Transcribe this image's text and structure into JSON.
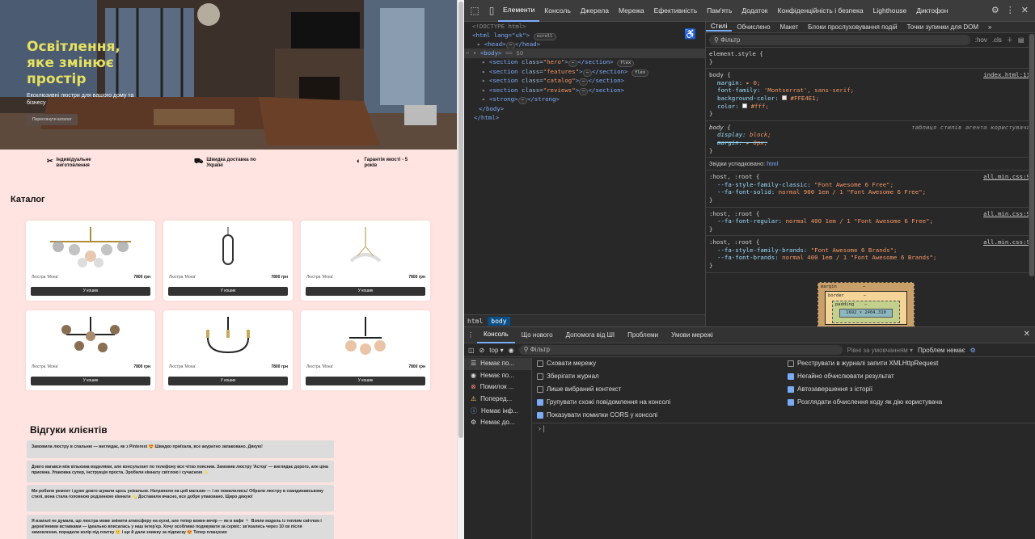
{
  "hero": {
    "title": "Освітлення, яке змінює простір",
    "subtitle": "Ексклюзивні люстри для вашого дому та бізнесу",
    "button": "Переглянути каталог"
  },
  "features": [
    {
      "icon": "tools-icon",
      "label": "Індивідуальне виготовлення"
    },
    {
      "icon": "truck-icon",
      "label": "Швидка доставка по Україні"
    },
    {
      "icon": "shield-icon",
      "label": "Гарантія якості - 5 років"
    }
  ],
  "catalog": {
    "title": "Каталог",
    "items": [
      {
        "name": "Люстра 'Мона'",
        "price": "7800 грн",
        "button": "У кошик"
      },
      {
        "name": "Люстра 'Мона'",
        "price": "7800 грн",
        "button": "У кошик"
      },
      {
        "name": "Люстра 'Мона'",
        "price": "7800 грн",
        "button": "У кошик"
      },
      {
        "name": "Люстра 'Мона'",
        "price": "7800 грн",
        "button": "У кошик"
      },
      {
        "name": "Люстра 'Мона'",
        "price": "7800 грн",
        "button": "У кошик"
      },
      {
        "name": "Люстра 'Мона'",
        "price": "7800 грн",
        "button": "У кошик"
      }
    ]
  },
  "reviews": {
    "title": "Відгуки клієнтів",
    "items": [
      "Замовила люстру в спальню — виглядає, як з Pinterest 😍 Швидко приїхала, все акуратно запаковано. Дякую!",
      "Довго вагався між кількома моделями, але консультант по телефону все чітко пояснив. Замовив люстру 'Астор' — виглядає дорого, але ціна приємна. Упаковка супер, інструкція проста. Зробили кімнату світлою і сучасною ✨",
      "Ми робили ремонт і дуже довго шукали щось унікальне. Натрапили на цей магазин — і не помилились! Обрали люстру в скандинавському стилі, вона стала головною родзинкою кімнати 💫 Доставили вчасно, все добре упаковано. Щиро дякую!",
      "Я взагалі не думала, що люстра може змінити атмосферу на кухні, але тепер кожен вечір — як в кафе ☕ Взяли модель із теплим світлом і дерев'яними вставками — ідеально вписалась у наш інтер'єр. Хочу особливо подякувати за сервіс: зв'язались через 10 хв після замовлення, порадили колір під плитку 🙂 і ще й дали знижку за підписку 😍 Тепер плануємо"
    ]
  },
  "devtools": {
    "tabs": [
      "Елементи",
      "Консоль",
      "Джерела",
      "Мережа",
      "Ефективність",
      "Пам'ять",
      "Додаток",
      "Конфіденційність і безпека",
      "Lighthouse",
      "Диктофон"
    ],
    "active_tab": "Елементи",
    "dom": {
      "doctype": "<!DOCTYPE html>",
      "html_open": "<html lang=\"uk\">",
      "scroll_badge": "scroll",
      "head": "<head>",
      "head_close": "</head>",
      "body_open": "<body>",
      "body_eq": "== $0",
      "sections": [
        {
          "cls": "hero",
          "badge": "flex"
        },
        {
          "cls": "features",
          "badge": "flex"
        },
        {
          "cls": "catalog",
          "badge": ""
        },
        {
          "cls": "reviews",
          "badge": ""
        }
      ],
      "strong": "<strong>",
      "strong_close": "</strong>",
      "body_close": "</body>",
      "html_close": "</html>"
    },
    "breadcrumbs": [
      "html",
      "body"
    ],
    "styles_tabs": [
      "Стилі",
      "Обчислено",
      "Макет",
      "Блоки прослуховування подій",
      "Точки зупинки для DOM"
    ],
    "filter_placeholder": "Фільтр",
    "filter_tools": [
      ":hov",
      ".cls"
    ],
    "rules": {
      "element_style": "element.style {",
      "body_selector": "body {",
      "body_src": "index.html:11",
      "body_props": [
        {
          "k": "margin",
          "v": "▸ 0;"
        },
        {
          "k": "font-family",
          "v": "'Montserrat', sans-serif;"
        },
        {
          "k": "background-color",
          "v": "#FFE4E1;"
        },
        {
          "k": "color",
          "v": "#fff;"
        }
      ],
      "ua_selector": "body {",
      "ua_note": "таблиця стилів агента користувача",
      "ua_props": [
        {
          "k": "display",
          "v": "block;"
        },
        {
          "k": "margin",
          "v": "▸ 8px;"
        }
      ],
      "inherited_label": "Звідки успадковано:",
      "inherited_from": "html",
      "root_rules": [
        {
          "sel": ":host, :root {",
          "src": "all.min.css:9",
          "props": [
            {
              "k": "--fa-style-family-classic",
              "v": "\"Font Awesome 6 Free\";"
            },
            {
              "k": "--fa-font-solid",
              "v": "normal 900 1em / 1 \"Font Awesome 6 Free\";"
            }
          ]
        },
        {
          "sel": ":host, :root {",
          "src": "all.min.css:9",
          "props": [
            {
              "k": "--fa-font-regular",
              "v": "normal 400 1em / 1 \"Font Awesome 6 Free\";"
            }
          ]
        },
        {
          "sel": ":host, :root {",
          "src": "all.min.css:9",
          "props": [
            {
              "k": "--fa-style-family-brands",
              "v": "\"Font Awesome 6 Brands\";"
            },
            {
              "k": "--fa-font-brands",
              "v": "normal 400 1em / 1 \"Font Awesome 6 Brands\";"
            }
          ]
        }
      ],
      "close": "}"
    },
    "boxmodel": {
      "margin": "margin",
      "border": "border",
      "padding": "padding",
      "size": "1692 × 2404.310",
      "dash": "–"
    },
    "console": {
      "tabs": [
        "Консоль",
        "Що нового",
        "Допомога від ШІ",
        "Проблеми",
        "Умови мережі"
      ],
      "context": "top",
      "filter": "Фільтр",
      "levels": "Рівні за умовчанням",
      "issues": "Проблем немає",
      "sidebar": [
        {
          "icon": "list-icon",
          "label": "Немає по..."
        },
        {
          "icon": "user-icon",
          "label": "Немає по..."
        },
        {
          "icon": "error-icon",
          "label": "Помилок ..."
        },
        {
          "icon": "warning-icon",
          "label": "Поперед..."
        },
        {
          "icon": "info-icon",
          "label": "Немає інф..."
        },
        {
          "icon": "gear-icon",
          "label": "Немає до..."
        }
      ],
      "options_left": [
        {
          "label": "Сховати мережу",
          "checked": false
        },
        {
          "label": "Зберігати журнал",
          "checked": false
        },
        {
          "label": "Лише вибраний контекст",
          "checked": false
        },
        {
          "label": "Групувати схожі повідомлення на консолі",
          "checked": true
        },
        {
          "label": "Показувати помилки CORS у консолі",
          "checked": true
        }
      ],
      "options_right": [
        {
          "label": "Реєструвати в журналі запити XMLHttpRequest",
          "checked": false
        },
        {
          "label": "Негайно обчислювати результат",
          "checked": true
        },
        {
          "label": "Автозавершення з історії",
          "checked": true
        },
        {
          "label": "Розглядати обчислення коду як дію користувача",
          "checked": true
        }
      ]
    }
  }
}
